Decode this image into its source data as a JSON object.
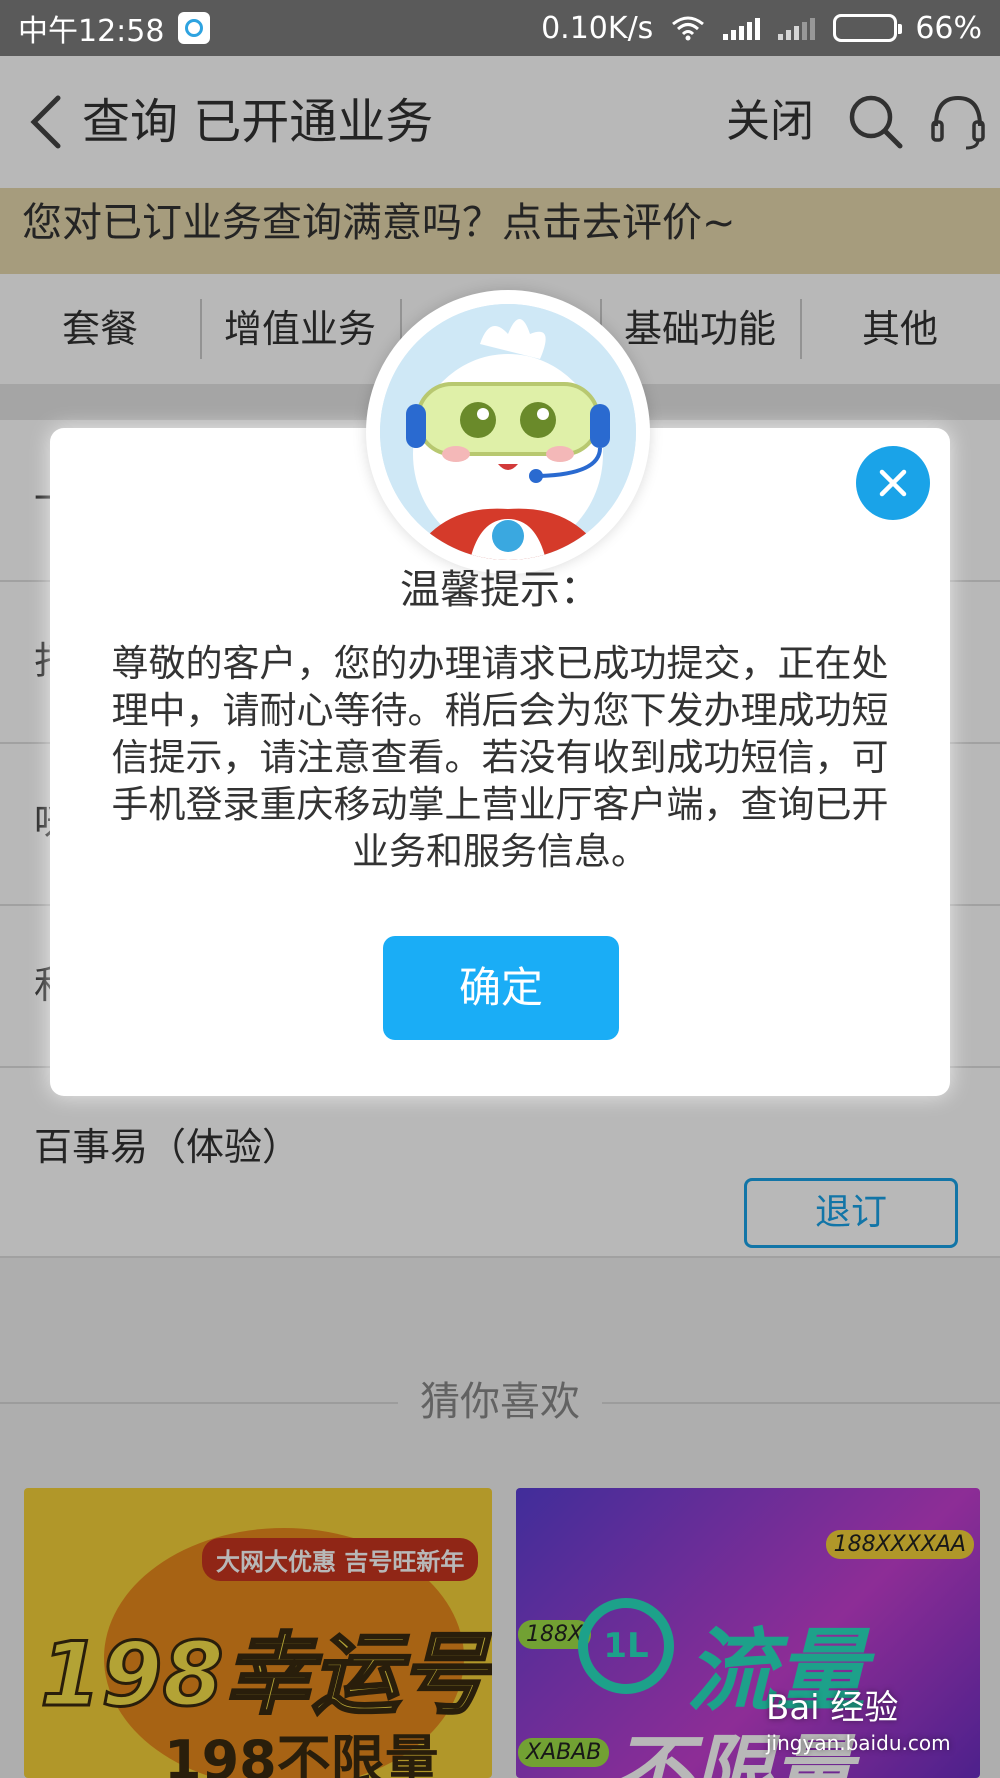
{
  "status_bar": {
    "time": "中午12:58",
    "net_speed": "0.10K/s",
    "battery": "66%",
    "battery_level": 0.66
  },
  "header": {
    "title": "查询 已开通业务",
    "close_label": "关闭"
  },
  "banner": {
    "text": "您对已订业务查询满意吗？点击去评价~"
  },
  "tabs": [
    {
      "label": "套餐"
    },
    {
      "label": "增值业务"
    },
    {
      "label": ""
    },
    {
      "label": "基础功能"
    },
    {
      "label": "其他"
    }
  ],
  "list": {
    "items": [
      {
        "name": "一",
        "button": ""
      },
      {
        "name": "打",
        "button": ""
      },
      {
        "name": "咪",
        "button": ""
      },
      {
        "name": "和",
        "button": ""
      },
      {
        "name": "百事易（体验）",
        "button": "退订"
      }
    ]
  },
  "recommend": {
    "title": "猜你喜欢",
    "promo1": {
      "tag": "大网大优惠 吉号旺新年",
      "big": "198幸运号",
      "sub": "198不限量"
    },
    "promo2": {
      "num_a": "188XXXXAA",
      "num_b": "188X",
      "num_c": "XABAB",
      "logo": "1L",
      "big": "流量",
      "sub": "不限量"
    }
  },
  "dialog": {
    "title": "温馨提示：",
    "message": "尊敬的客户，您的办理请求已成功提交，正在处理中，请耐心等待。稍后会为您下发办理成功短信提示，请注意查看。若没有收到成功短信，可手机登录重庆移动掌上营业厅客户端，查询已开业务和服务信息。",
    "confirm_label": "确定"
  },
  "watermark": {
    "text": "Bai 经验",
    "url": "jingyan.baidu.com"
  },
  "colors": {
    "accent": "#1aa3e8",
    "confirm": "#1aadf6",
    "banner": "#e6d9ad",
    "status_bar": "#5a5a5a"
  }
}
